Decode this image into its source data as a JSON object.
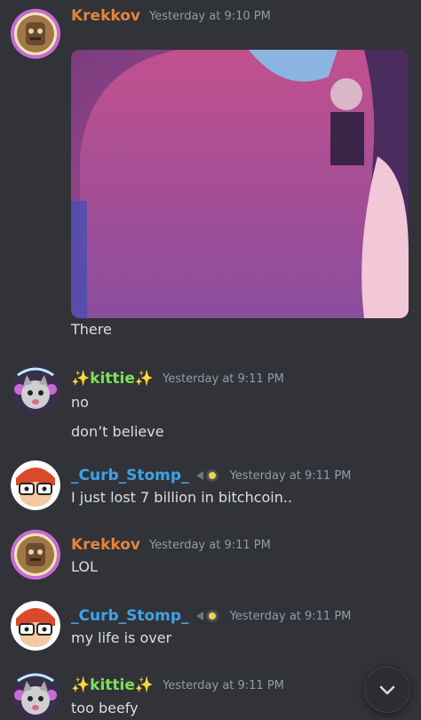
{
  "messages": [
    {
      "username": "Krekkov",
      "timestamp": "Yesterday at 9:10 PM",
      "text": "There"
    },
    {
      "username": "✨kittie✨",
      "timestamp": "Yesterday at 9:11 PM",
      "lines": [
        "no",
        "don’t believe"
      ]
    },
    {
      "username": "_Curb_Stomp_",
      "timestamp": "Yesterday at 9:11 PM",
      "text": "I just lost 7 billion in bitchcoin.."
    },
    {
      "username": "Krekkov",
      "timestamp": "Yesterday at 9:11 PM",
      "text": "LOL"
    },
    {
      "username": "_Curb_Stomp_",
      "timestamp": "Yesterday at 9:11 PM",
      "text": "my life is over"
    },
    {
      "username": "✨kittie✨",
      "timestamp": "Yesterday at 9:11 PM",
      "text": "too beefy"
    }
  ],
  "colors": {
    "background": "#313338",
    "krekkov": "#e8833a",
    "kittie": "#7ee05a",
    "curb_stomp": "#3ea3e8",
    "timestamp": "#949ba4",
    "text": "#dbdee1"
  },
  "icons": {
    "scroll_down": "chevron-down-icon",
    "server_badge": "badge-icon"
  }
}
